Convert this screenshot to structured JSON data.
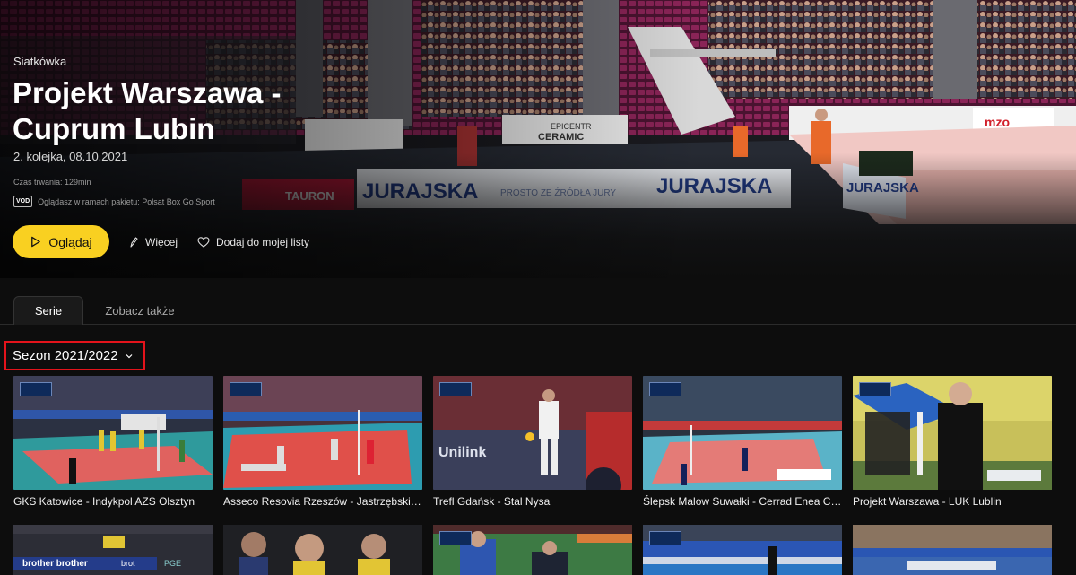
{
  "hero": {
    "category": "Siatkówka",
    "title": "Projekt Warszawa - Cuprum Lubin",
    "subtitle": "2. kolejka, 08.10.2021",
    "duration": "Czas trwania: 129min",
    "vod_badge": "VOD",
    "package": "Oglądasz w ramach pakietu: Polsat Box Go Sport",
    "arena_banners": [
      "TAURON",
      "JURAJSKA",
      "PROSTO ZE ŹRÓDŁA JURY",
      "JURAJSKA",
      "EPICENTR CERAMIC",
      "mzo",
      "JURAJSKA"
    ]
  },
  "actions": {
    "watch_label": "Oglądaj",
    "more_label": "Więcej",
    "add_list_label": "Dodaj do mojej listy"
  },
  "tabs": {
    "active": "Serie",
    "inactive": "Zobacz także"
  },
  "season": {
    "label": "Sezon 2021/2022",
    "highlight_color": "#e3131b"
  },
  "episodes": [
    {
      "title": "GKS Katowice - Indykpol AZS Olsztyn"
    },
    {
      "title": "Asseco Resovia Rzeszów - Jastrzębski Węgiel"
    },
    {
      "title": "Trefl Gdańsk - Stal Nysa"
    },
    {
      "title": "Ślepsk Malow Suwałki - Cerrad Enea Czarni Radom"
    },
    {
      "title": "Projekt Warszawa - LUK Lublin"
    }
  ],
  "colors": {
    "accent": "#f9d021",
    "background": "#0d0d0d"
  },
  "icons": {
    "play": "play-icon",
    "more": "pen-icon",
    "heart": "heart-icon",
    "chevron": "chevron-down-icon"
  }
}
